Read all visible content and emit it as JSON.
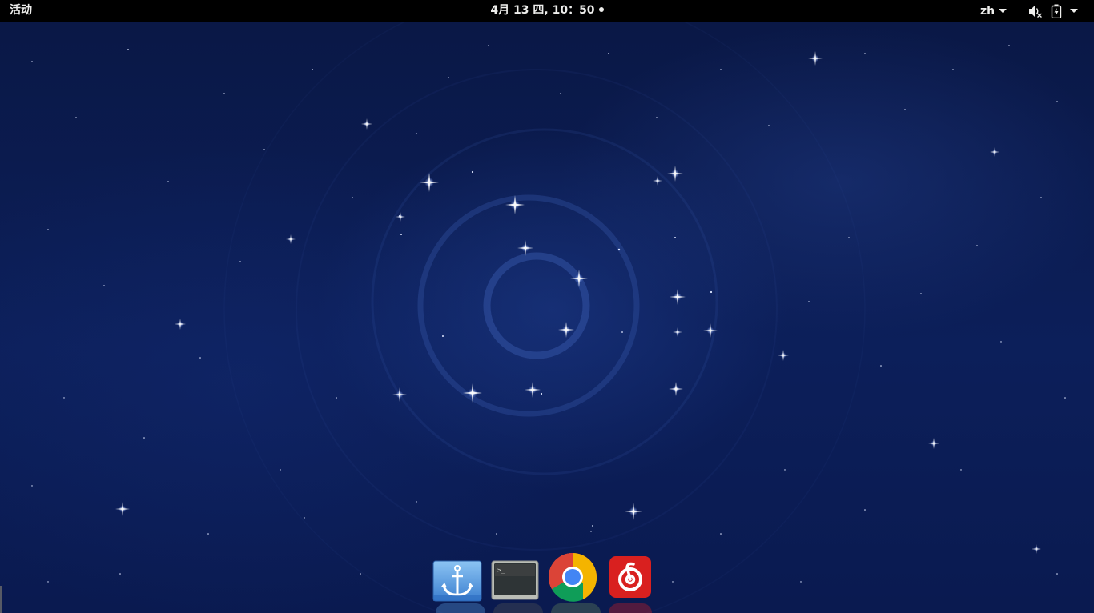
{
  "topbar": {
    "activities_label": "活动",
    "clock_label": "4月 13 四, 10：50",
    "language_label": "zh",
    "volume_icon": "speaker-muted-icon",
    "battery_icon": "battery-charging-icon",
    "system_menu_icon": "chevron-down-icon"
  },
  "dock": {
    "items": [
      {
        "name": "anchor-app",
        "icon": "anchor-icon"
      },
      {
        "name": "terminal",
        "icon": "terminal-icon"
      },
      {
        "name": "google-chrome",
        "icon": "chrome-icon"
      },
      {
        "name": "netease-cloud-music",
        "icon": "netease-music-icon"
      }
    ]
  },
  "colors": {
    "topbar_bg": "#000000",
    "topbar_text": "#eeeeec",
    "wallpaper_base": "#0c1f5a",
    "anchor_tile": "#5b9fe0",
    "terminal_tile": "#2e3436",
    "music_tile": "#d9201f"
  }
}
